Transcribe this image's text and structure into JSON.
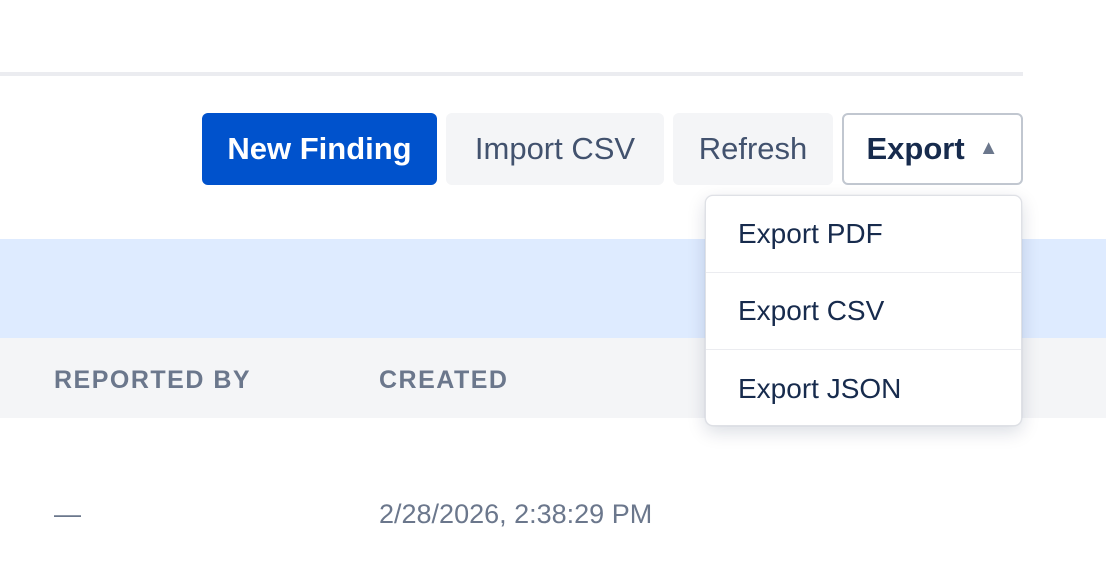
{
  "toolbar": {
    "new_finding_label": "New Finding",
    "import_csv_label": "Import CSV",
    "refresh_label": "Refresh",
    "export_label": "Export",
    "export_caret_icon": "caret-up-icon"
  },
  "export_menu": {
    "items": [
      {
        "label": "Export PDF"
      },
      {
        "label": "Export CSV"
      },
      {
        "label": "Export JSON"
      }
    ]
  },
  "table": {
    "columns": [
      "REPORTED BY",
      "CREATED"
    ],
    "rows": [
      {
        "reported_by": "—",
        "created": "2/28/2026, 2:38:29 PM"
      }
    ]
  },
  "colors": {
    "primary": "#0052cc",
    "subtle_bg": "#f4f5f7",
    "info_band": "#deebff",
    "text_dark": "#172b4d",
    "text_muted": "#6b778c"
  }
}
